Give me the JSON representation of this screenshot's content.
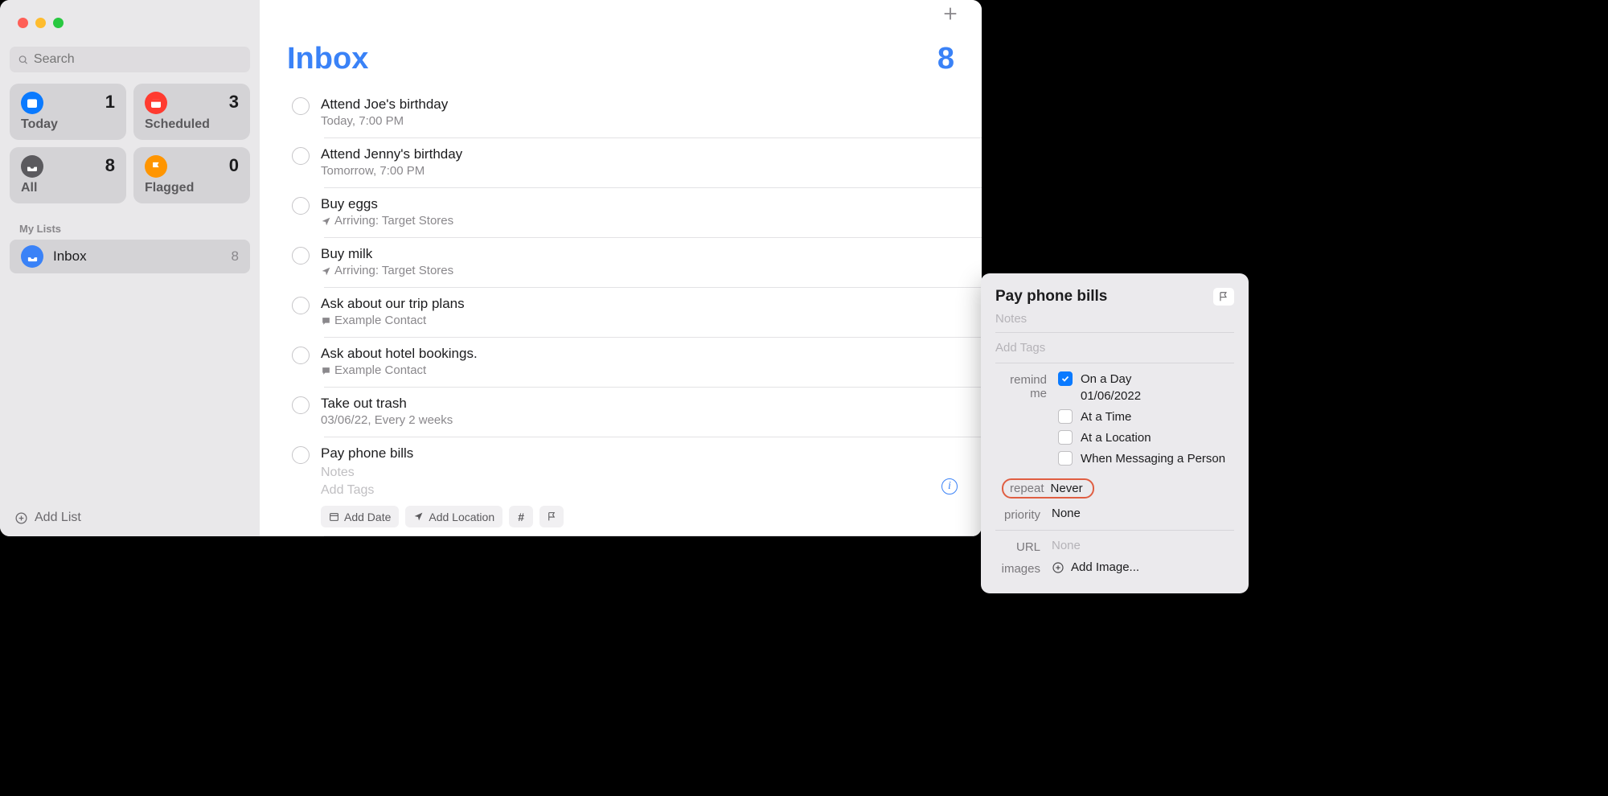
{
  "search": {
    "placeholder": "Search"
  },
  "smartLists": {
    "today": {
      "label": "Today",
      "count": "1"
    },
    "scheduled": {
      "label": "Scheduled",
      "count": "3"
    },
    "all": {
      "label": "All",
      "count": "8"
    },
    "flagged": {
      "label": "Flagged",
      "count": "0"
    }
  },
  "sidebar": {
    "myListsHeader": "My Lists",
    "inbox": {
      "name": "Inbox",
      "count": "8"
    },
    "addList": "Add List"
  },
  "header": {
    "title": "Inbox",
    "count": "8"
  },
  "reminders": [
    {
      "title": "Attend Joe's birthday",
      "meta": "Today, 7:00 PM",
      "metaIcon": ""
    },
    {
      "title": "Attend Jenny's birthday",
      "meta": "Tomorrow, 7:00 PM",
      "metaIcon": ""
    },
    {
      "title": "Buy eggs",
      "meta": "Arriving: Target Stores",
      "metaIcon": "location"
    },
    {
      "title": "Buy milk",
      "meta": "Arriving: Target Stores",
      "metaIcon": "location"
    },
    {
      "title": "Ask about our trip plans",
      "meta": "Example Contact",
      "metaIcon": "message"
    },
    {
      "title": "Ask about hotel bookings.",
      "meta": "Example Contact",
      "metaIcon": "message"
    },
    {
      "title": "Take out trash",
      "meta": "03/06/22, Every 2 weeks",
      "metaIcon": ""
    },
    {
      "title": "Pay phone bills",
      "meta": "",
      "metaIcon": ""
    }
  ],
  "selected": {
    "notesPlaceholder": "Notes",
    "tagsPlaceholder": "Add Tags",
    "chipDate": "Add Date",
    "chipLocation": "Add Location"
  },
  "details": {
    "title": "Pay phone bills",
    "notesPlaceholder": "Notes",
    "tagsPlaceholder": "Add Tags",
    "remindLabel": "remind me",
    "onADay": "On a Day",
    "date": "01/06/2022",
    "atATime": "At a Time",
    "atALocation": "At a Location",
    "whenMessaging": "When Messaging a Person",
    "repeatLabel": "repeat",
    "repeatValue": "Never",
    "priorityLabel": "priority",
    "priorityValue": "None",
    "urlLabel": "URL",
    "urlPlaceholder": "None",
    "imagesLabel": "images",
    "addImage": "Add Image..."
  }
}
